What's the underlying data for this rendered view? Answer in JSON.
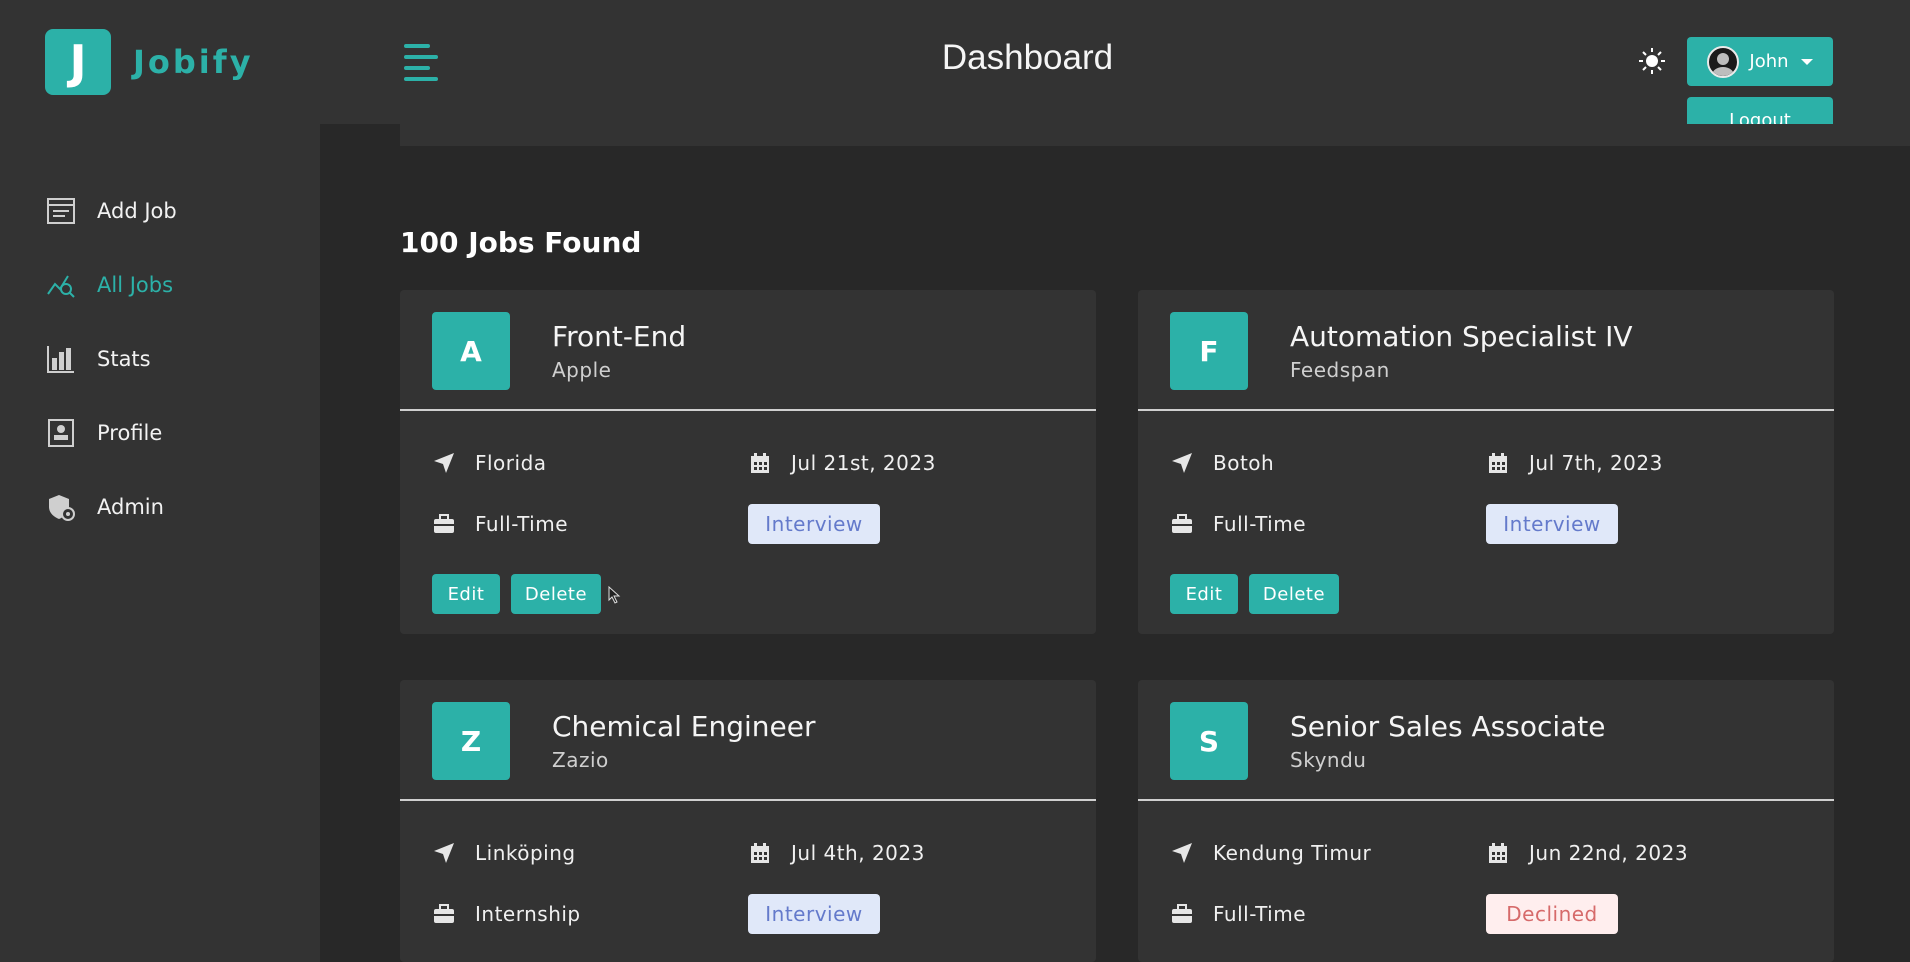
{
  "brand": {
    "letter": "J",
    "name": "Jobify",
    "accent": "#2cb1a8"
  },
  "sidebar": {
    "items": [
      {
        "label": "Add Job",
        "icon": "add-job-icon",
        "active": false
      },
      {
        "label": "All Jobs",
        "icon": "all-jobs-icon",
        "active": true
      },
      {
        "label": "Stats",
        "icon": "stats-icon",
        "active": false
      },
      {
        "label": "Profile",
        "icon": "profile-icon",
        "active": false
      },
      {
        "label": "Admin",
        "icon": "admin-icon",
        "active": false
      }
    ]
  },
  "header": {
    "title": "Dashboard",
    "user_name": "John",
    "logout_label": "Logout",
    "theme_icon": "sun-icon"
  },
  "main": {
    "jobs_found": "100 Jobs Found",
    "edit_label": "Edit",
    "delete_label": "Delete",
    "jobs": [
      {
        "letter": "A",
        "position": "Front-End",
        "company": "Apple",
        "location": "Florida",
        "date": "Jul 21st, 2023",
        "type": "Full-Time",
        "status": "Interview"
      },
      {
        "letter": "F",
        "position": "Automation Specialist IV",
        "company": "Feedspan",
        "location": "Botoh",
        "date": "Jul 7th, 2023",
        "type": "Full-Time",
        "status": "Interview"
      },
      {
        "letter": "Z",
        "position": "Chemical Engineer",
        "company": "Zazio",
        "location": "Linköping",
        "date": "Jul 4th, 2023",
        "type": "Internship",
        "status": "Interview"
      },
      {
        "letter": "S",
        "position": "Senior Sales Associate",
        "company": "Skyndu",
        "location": "Kendung Timur",
        "date": "Jun 22nd, 2023",
        "type": "Full-Time",
        "status": "Declined"
      }
    ]
  },
  "colors": {
    "interview_bg": "#e0e8f9",
    "interview_text": "#647acb",
    "declined_bg": "#ffeeee",
    "declined_text": "#d66a6a"
  }
}
